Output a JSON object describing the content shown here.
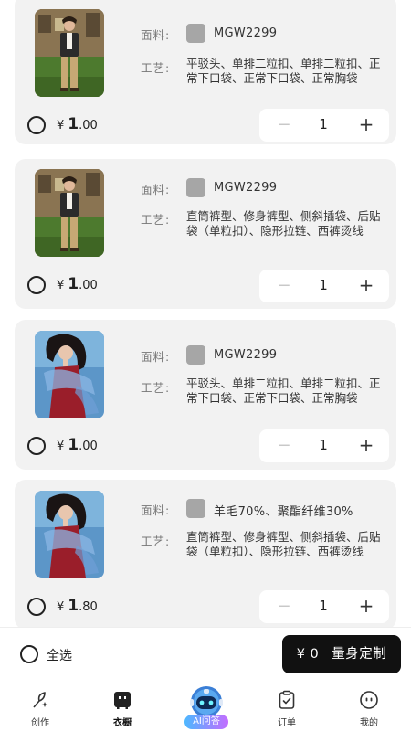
{
  "cart": {
    "labels": {
      "fabric": "面料:",
      "craft": "工艺:"
    },
    "items": [
      {
        "image": "man-in-suit-photo",
        "fabric": "MGW2299",
        "craft": "平驳头、单排二粒扣、单排二粒扣、正常下口袋、正常下口袋、正常胸袋",
        "currency": "¥",
        "price_int": "1",
        "price_dec": ".00",
        "qty": "1",
        "minus": "−",
        "plus": "+"
      },
      {
        "image": "man-in-suit-photo",
        "fabric": "MGW2299",
        "craft": "直筒裤型、修身裤型、侧斜插袋、后贴袋（单粒扣）、隐形拉链、西裤烫线",
        "currency": "¥",
        "price_int": "1",
        "price_dec": ".00",
        "qty": "1",
        "minus": "−",
        "plus": "+"
      },
      {
        "image": "woman-red-dress-photo",
        "fabric": "MGW2299",
        "craft": "平驳头、单排二粒扣、单排二粒扣、正常下口袋、正常下口袋、正常胸袋",
        "currency": "¥",
        "price_int": "1",
        "price_dec": ".00",
        "qty": "1",
        "minus": "−",
        "plus": "+"
      },
      {
        "image": "woman-red-dress-photo",
        "fabric": "羊毛70%、聚酯纤维30%",
        "craft": "直筒裤型、修身裤型、侧斜插袋、后贴袋（单粒扣）、隐形拉链、西裤烫线",
        "currency": "¥",
        "price_int": "1",
        "price_dec": ".80",
        "qty": "1",
        "minus": "−",
        "plus": "+"
      }
    ]
  },
  "footer": {
    "select_all": "全选",
    "total": "¥ 0",
    "checkout": "量身定制"
  },
  "tabbar": {
    "create": "创作",
    "wardrobe": "衣橱",
    "ai": "AI问答",
    "orders": "订单",
    "mine": "我的"
  },
  "colors": {
    "card_bg": "#f2f2f2",
    "swatch": "#a6a6a6",
    "checkout_bg": "#111111",
    "ai_gradient_start": "#4db8ff",
    "ai_gradient_end": "#c46cff"
  }
}
